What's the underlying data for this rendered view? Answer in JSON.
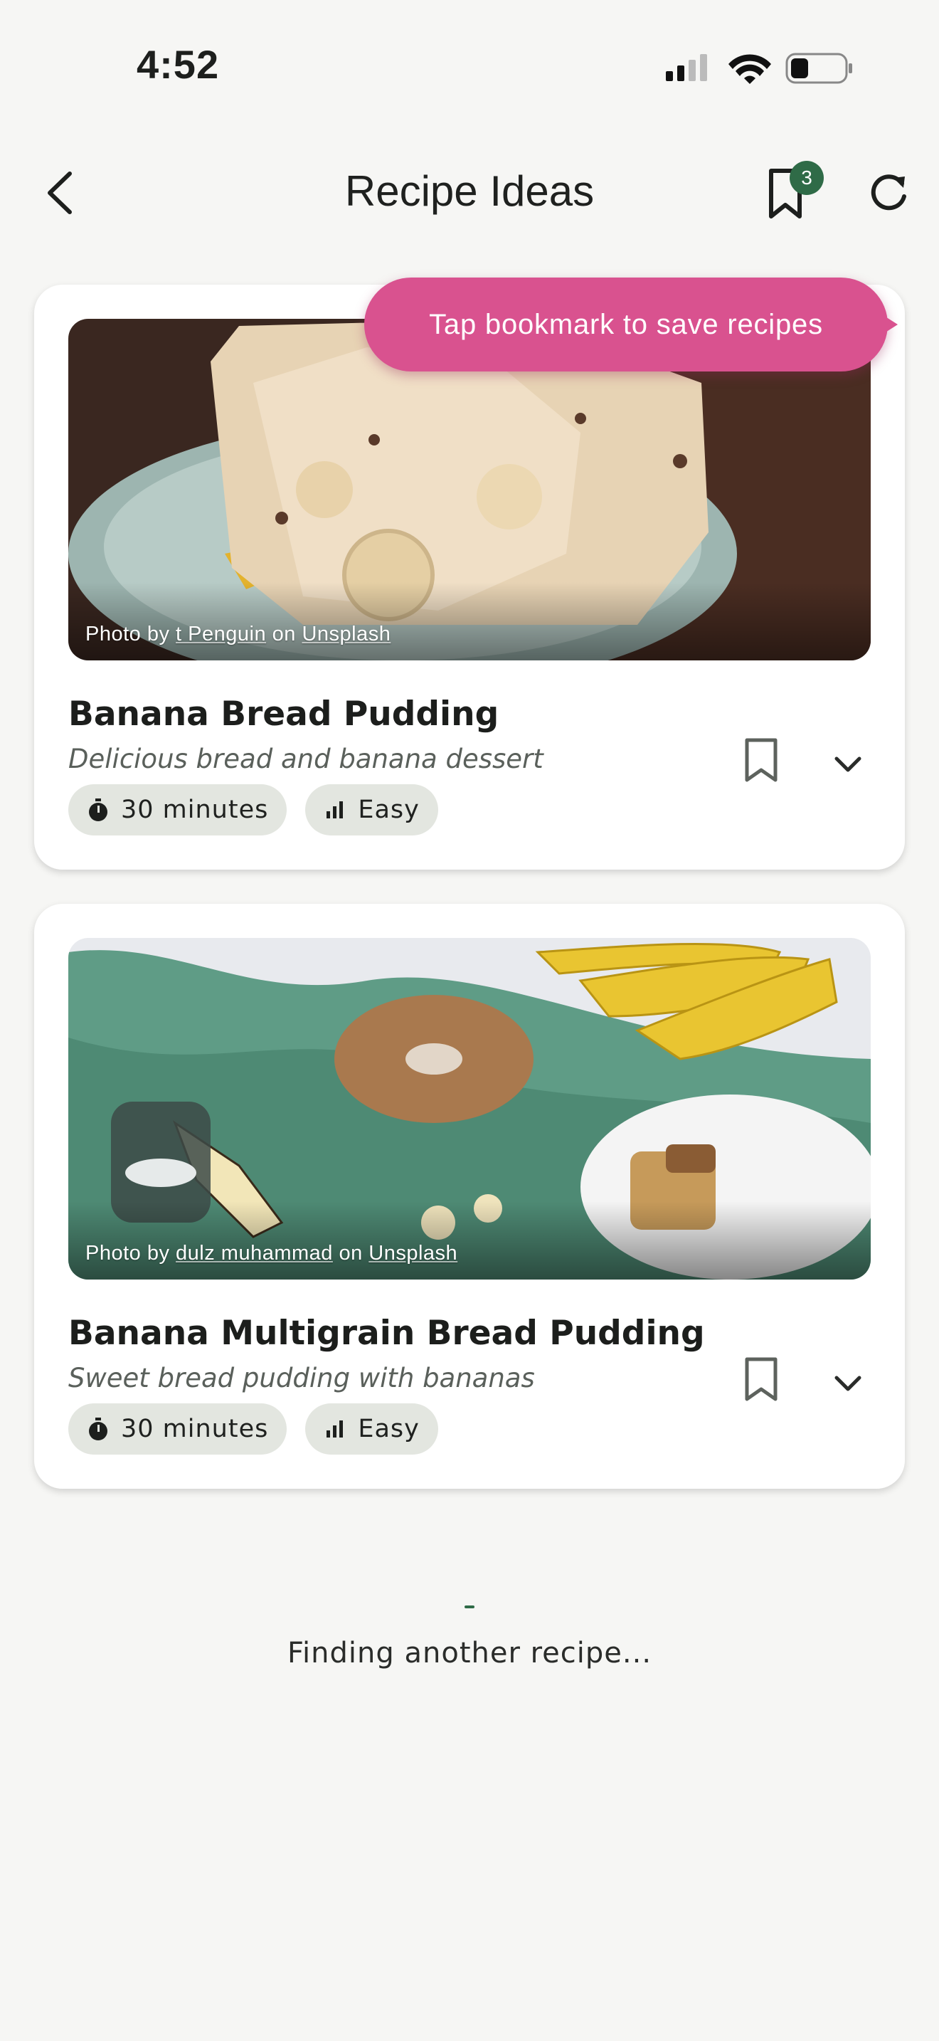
{
  "status_bar": {
    "time": "4:52",
    "icons": [
      "cellular-signal-icon",
      "wifi-icon",
      "battery-icon"
    ]
  },
  "nav": {
    "title": "Recipe Ideas",
    "back_icon": "chevron-left-icon",
    "bookmark_icon": "bookmark-icon",
    "bookmark_count": "3",
    "refresh_icon": "refresh-icon"
  },
  "tooltip": {
    "text": "Tap bookmark to save recipes"
  },
  "recipes": [
    {
      "title": "Banana Bread Pudding",
      "description": "Delicious bread and banana dessert",
      "credit_prefix": "Photo by ",
      "credit_author": "t Penguin",
      "credit_mid": " on ",
      "credit_source": "Unsplash",
      "time": "30 minutes",
      "difficulty": "Easy"
    },
    {
      "title": "Banana Multigrain Bread Pudding",
      "description": "Sweet bread pudding with bananas",
      "credit_prefix": "Photo by ",
      "credit_author": "dulz muhammad",
      "credit_mid": " on ",
      "credit_source": "Unsplash",
      "time": "30 minutes",
      "difficulty": "Easy"
    }
  ],
  "loading": {
    "text": "Finding another recipe..."
  },
  "colors": {
    "accent": "#2f6b47",
    "tooltip": "#d9528f",
    "chip": "#e3e6e0",
    "background": "#f6f6f4"
  }
}
